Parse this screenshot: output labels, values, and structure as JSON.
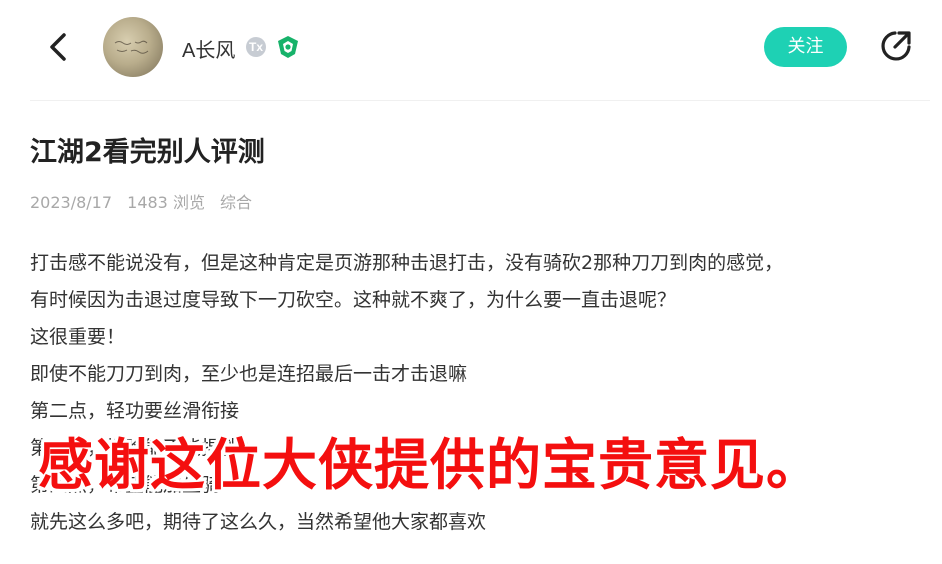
{
  "header": {
    "username": "A长风",
    "level_badge": "Tx",
    "follow_label": "关注",
    "accent_color": "#1ed1b4",
    "back_icon": "chevron-left-icon",
    "share_icon": "share-arrow-icon",
    "verified_icon": "shield-badge-icon"
  },
  "post": {
    "title": "江湖2看完别人评测",
    "date": "2023/8/17",
    "views": "1483 浏览",
    "category": "综合",
    "lines": [
      "打击感不能说没有，但是这种肯定是页游那种击退打击，没有骑砍2那种刀刀到肉的感觉，",
      "有时候因为击退过度导致下一刀砍空。这种就不爽了，为什么要一直击退呢？",
      "这很重要！",
      "即使不能刀刀到肉，至少也是连招最后一击才击退嘛",
      "第二点，轻功要丝滑衔接",
      "第三点，捏脸能不能捏胖？",
      "第四点，希望能加坐骑",
      "就先这么多吧，期待了这么久，当然希望他大家都喜欢"
    ]
  },
  "overlay": {
    "caption": "感谢这位大侠提供的宝贵意见。",
    "color": "#f40f0f"
  }
}
